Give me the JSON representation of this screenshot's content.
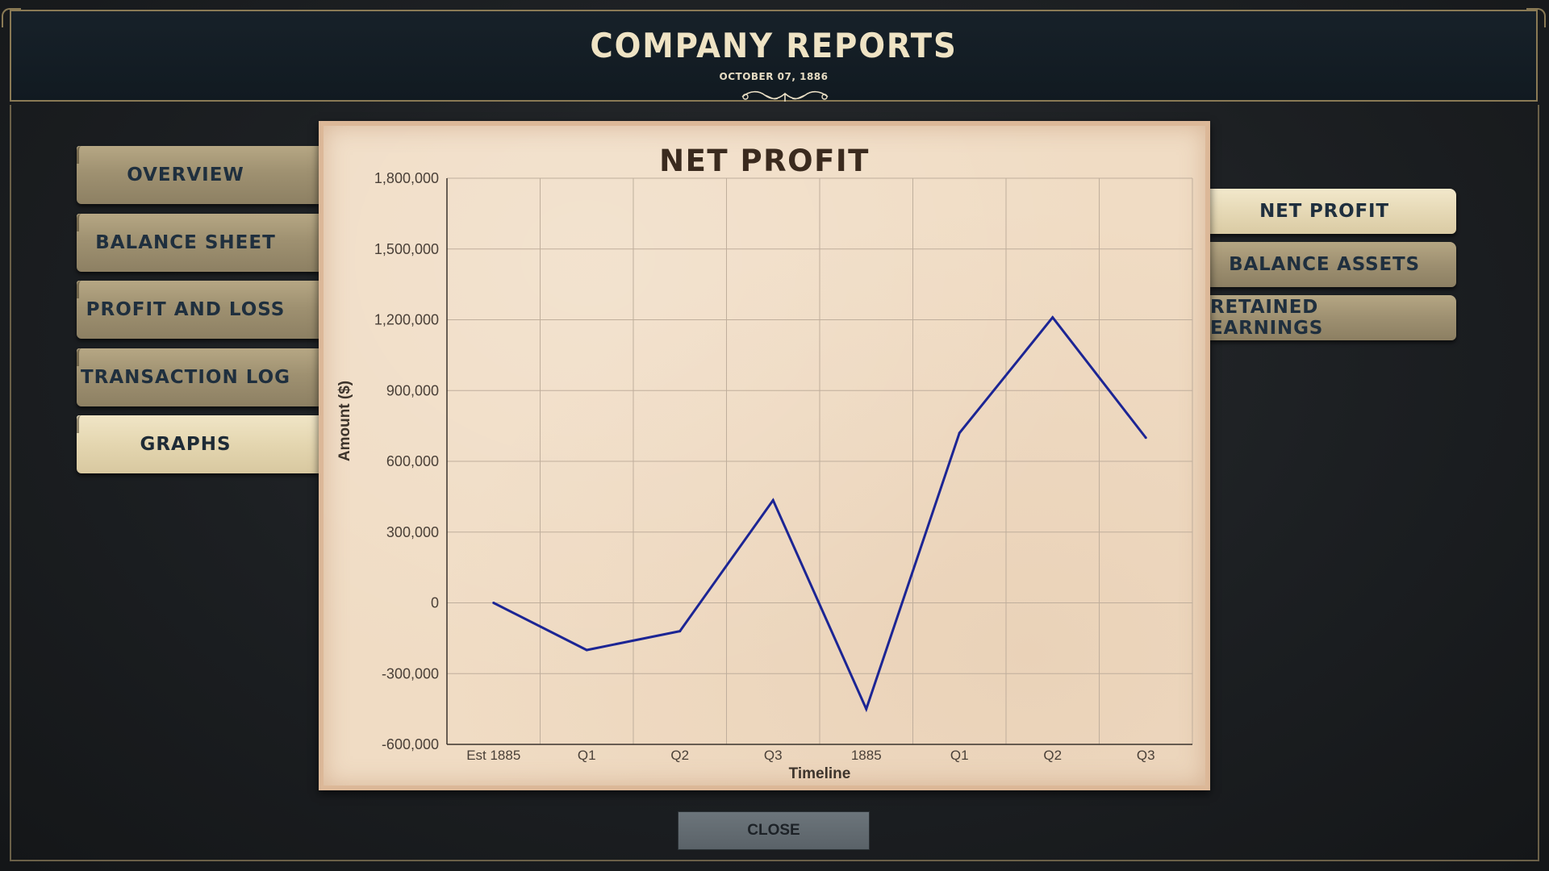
{
  "header": {
    "title": "COMPANY REPORTS",
    "date": "OCTOBER 07, 1886"
  },
  "left_nav": [
    {
      "label": "OVERVIEW",
      "active": false
    },
    {
      "label": "BALANCE SHEET",
      "active": false
    },
    {
      "label": "PROFIT AND LOSS",
      "active": false
    },
    {
      "label": "TRANSACTION LOG",
      "active": false
    },
    {
      "label": "GRAPHS",
      "active": true
    }
  ],
  "graph_tabs": [
    {
      "label": "NET PROFIT",
      "active": true
    },
    {
      "label": "BALANCE ASSETS",
      "active": false
    },
    {
      "label": "RETAINED EARNINGS",
      "active": false
    }
  ],
  "close_label": "CLOSE",
  "colors": {
    "line": "#1c2594",
    "parchment": "#f0dcc4",
    "title_text": "#efe3c4"
  },
  "chart_data": {
    "type": "line",
    "title": "NET PROFIT",
    "xlabel": "Timeline",
    "ylabel": "Amount ($)",
    "categories": [
      "Est 1885",
      "Q1",
      "Q2",
      "Q3",
      "1885",
      "Q1",
      "Q2",
      "Q3"
    ],
    "series": [
      {
        "values": [
          0,
          -200000,
          -120000,
          435000,
          -450000,
          720000,
          1210000,
          700000
        ]
      }
    ],
    "ylim": [
      -600000,
      1800000
    ],
    "yticks": [
      "-600,000",
      "-300,000",
      "0",
      "300,000",
      "600,000",
      "900,000",
      "1,200,000",
      "1,500,000",
      "1,800,000"
    ],
    "ytick_values": [
      -600000,
      -300000,
      0,
      300000,
      600000,
      900000,
      1200000,
      1500000,
      1800000
    ],
    "grid": true
  }
}
